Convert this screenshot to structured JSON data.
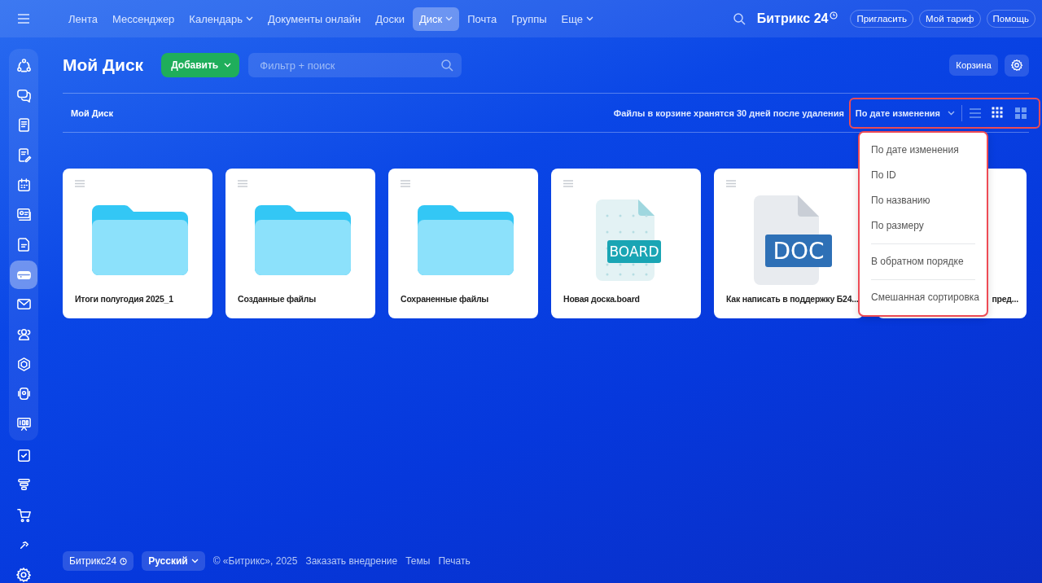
{
  "topbar": {
    "nav": [
      {
        "label": "Лента",
        "selected": false,
        "dropdown": false
      },
      {
        "label": "Мессенджер",
        "selected": false,
        "dropdown": false
      },
      {
        "label": "Календарь",
        "selected": false,
        "dropdown": true
      },
      {
        "label": "Документы онлайн",
        "selected": false,
        "dropdown": false
      },
      {
        "label": "Доски",
        "selected": false,
        "dropdown": false
      },
      {
        "label": "Диск",
        "selected": true,
        "dropdown": true
      },
      {
        "label": "Почта",
        "selected": false,
        "dropdown": false
      },
      {
        "label": "Группы",
        "selected": false,
        "dropdown": false
      },
      {
        "label": "Еще",
        "selected": false,
        "dropdown": true
      }
    ],
    "logo": "Битрикс 24",
    "buttons": [
      "Пригласить",
      "Мой тариф",
      "Помощь"
    ]
  },
  "sidebar": {
    "items": [
      {
        "selected": false
      },
      {
        "selected": false
      },
      {
        "selected": false
      },
      {
        "selected": false
      },
      {
        "selected": false
      },
      {
        "selected": false
      },
      {
        "selected": false
      },
      {
        "selected": true
      },
      {
        "selected": false
      },
      {
        "selected": false
      },
      {
        "selected": false
      },
      {
        "selected": false
      },
      {
        "selected": false
      },
      {
        "selected": false
      },
      {
        "selected": false
      },
      {
        "selected": false
      },
      {
        "selected": false
      }
    ]
  },
  "page": {
    "title": "Мой Диск",
    "add_button": "Добавить",
    "search": {
      "placeholder": "Фильтр + поиск"
    },
    "trash_button": "Корзина"
  },
  "toolbar": {
    "breadcrumb": "Мой Диск",
    "notice": "Файлы в корзине хранятся 30 дней после удаления",
    "sort": "По дате изменения",
    "view_modes": [
      {
        "selected": false
      },
      {
        "selected": true
      },
      {
        "selected": false
      }
    ]
  },
  "sort_menu": {
    "groups": [
      {
        "items": [
          "По дате изменения",
          "По ID",
          "По названию",
          "По размеру"
        ]
      },
      {
        "items": [
          "В обратном порядке"
        ]
      },
      {
        "items": [
          "Смешанная сортировка"
        ]
      }
    ]
  },
  "cards": [
    {
      "kind": "folder",
      "title": "Итоги полугодия 2025_1"
    },
    {
      "kind": "folder",
      "title": "Созданные файлы"
    },
    {
      "kind": "folder",
      "title": "Сохраненные файлы"
    },
    {
      "kind": "board",
      "badge": "BOARD",
      "title": "Новая доска.board"
    },
    {
      "kind": "doc",
      "badge": "DOC",
      "title": "Как написать в поддержку Б24..."
    },
    {
      "title": "пред..."
    }
  ],
  "footer": {
    "brand": "Битрикс24",
    "language": "Русский",
    "copyright": "© «Битрикс», 2025",
    "links": [
      "Заказать внедрение",
      "Темы",
      "Печать"
    ]
  }
}
